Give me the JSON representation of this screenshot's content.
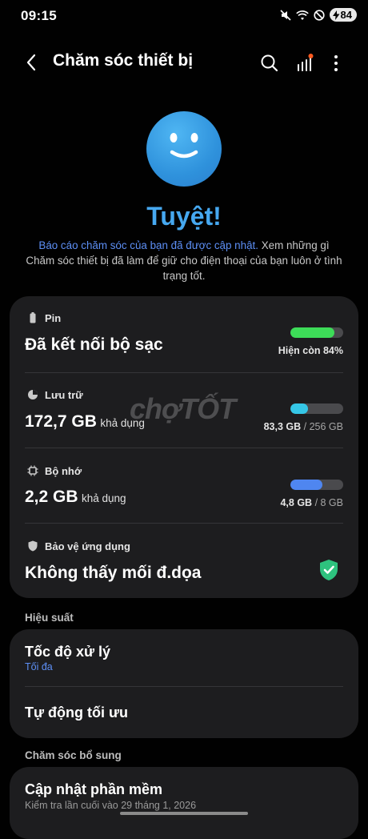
{
  "status_bar": {
    "time": "09:15",
    "battery": "84",
    "icons": [
      "mute-icon",
      "wifi-icon",
      "do-not-disturb-icon",
      "charging-icon"
    ]
  },
  "header": {
    "title": "Chăm sóc thiết bị",
    "icons": [
      "back-icon",
      "search-icon",
      "stats-icon",
      "more-icon"
    ]
  },
  "hero": {
    "headline": "Tuyệt!",
    "report_link": "Báo cáo chăm sóc của bạn đã được cập nhật.",
    "report_text": " Xem những gì Chăm sóc thiết bị đã làm để giữ cho điện thoại của bạn luôn ở tình trạng tốt."
  },
  "battery": {
    "label": "Pin",
    "status": "Đã kết nối bộ sạc",
    "remaining": "Hiện còn 84%",
    "level": 0.84,
    "color": "#3ddc58"
  },
  "storage": {
    "label": "Lưu trữ",
    "available": "172,7 GB",
    "available_suffix": "khả dụng",
    "used": "83,3 GB",
    "total": "/ 256 GB",
    "level": 0.33,
    "color": "#35c6e6"
  },
  "memory": {
    "label": "Bộ nhớ",
    "available": "2,2 GB",
    "available_suffix": "khả dụng",
    "used": "4,8 GB",
    "total": "/ 8 GB",
    "level": 0.6,
    "color": "#4f86f0"
  },
  "app_protection": {
    "label": "Bảo vệ ứng dụng",
    "status": "Không thấy mối đ.dọa",
    "color": "#2ec27e"
  },
  "performance": {
    "section_title": "Hiệu suất",
    "items": [
      {
        "title": "Tốc độ xử lý",
        "subtitle": "Tối đa"
      },
      {
        "title": "Tự động tối ưu"
      }
    ]
  },
  "extra_care": {
    "section_title": "Chăm sóc bổ sung",
    "items": [
      {
        "title": "Cập nhật phần mềm",
        "subtitle": "Kiểm tra lần cuối vào 29 tháng 1, 2026"
      }
    ]
  },
  "watermark": "chợTỐT"
}
